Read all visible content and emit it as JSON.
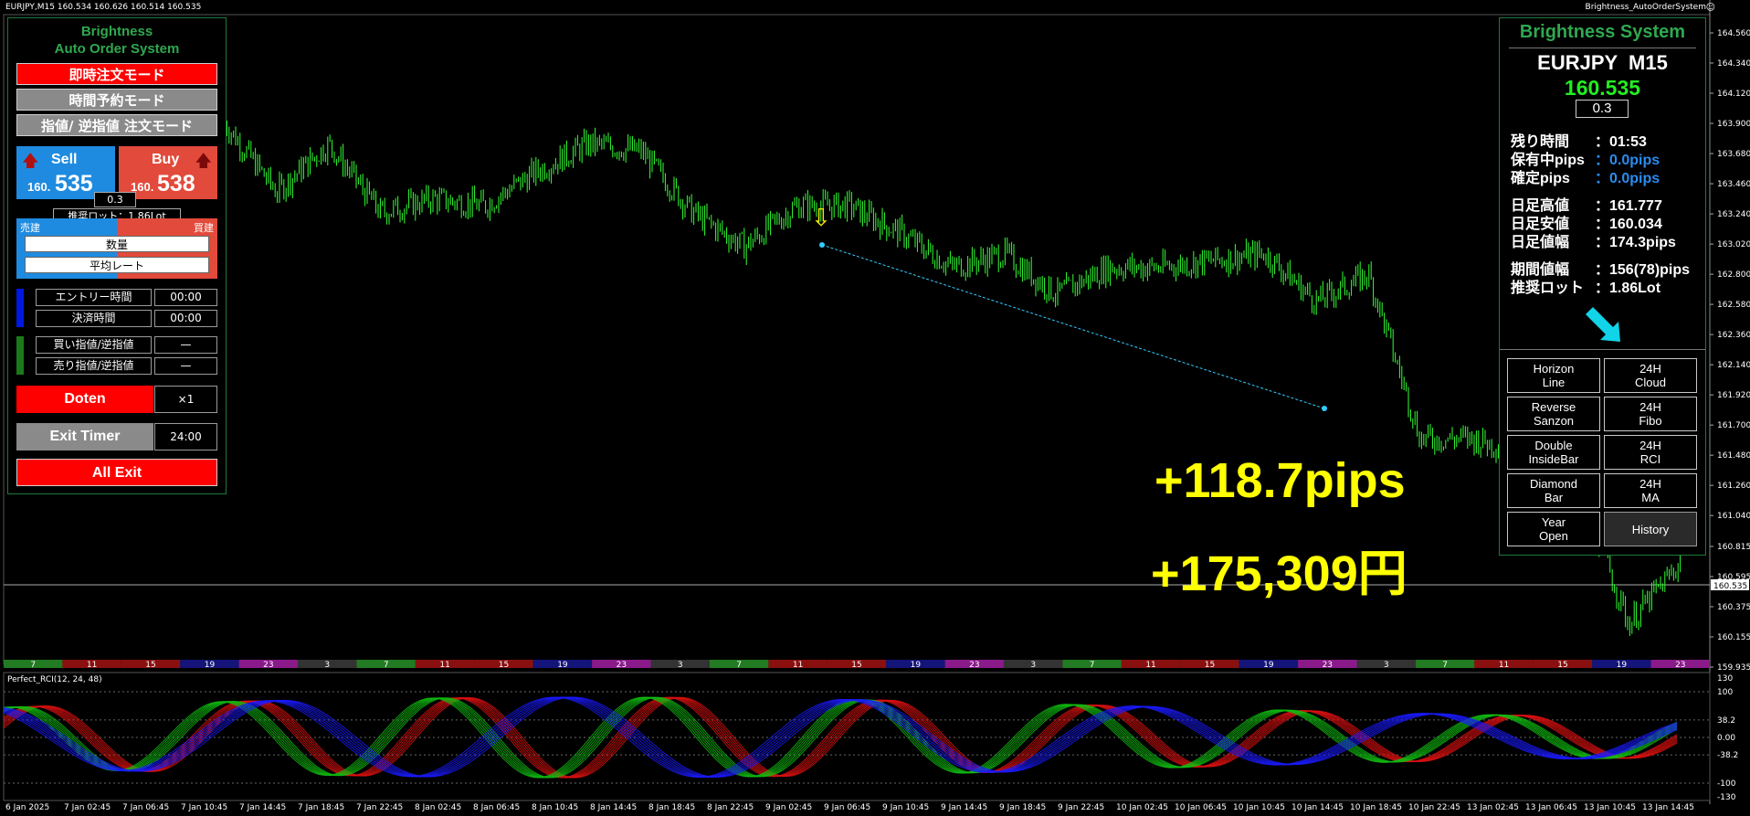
{
  "window": {
    "symbol_info": "EURJPY,M15  160.534 160.626 160.514 160.535",
    "expert_name": "Brightness_AutoOrderSystem",
    "rci_label": "Perfect_RCI(12, 24, 48)"
  },
  "left_panel": {
    "title_line1": "Brightness",
    "title_line2": "Auto Order System",
    "modes": [
      {
        "label": "即時注文モード",
        "active": true
      },
      {
        "label": "時間予約モード",
        "active": false
      },
      {
        "label": "指値/ 逆指値 注文モード",
        "active": false
      }
    ],
    "sell": {
      "label": "Sell",
      "price_small": "160.",
      "price_big": "535"
    },
    "buy": {
      "label": "Buy",
      "price_small": "160.",
      "price_big": "538"
    },
    "spread": "0.3",
    "lot_tooltip": "推奨ロット：1.86Lot",
    "bar_left_label": "売建",
    "bar_right_label": "買建",
    "quantity_label": "数量",
    "avg_rate_label": "平均レート",
    "entry_time_label": "エントリー時間",
    "entry_time_value": "00:00",
    "close_time_label": "決済時間",
    "close_time_value": "00:00",
    "buy_limit_label": "買い指値/逆指値",
    "buy_limit_value": "—",
    "sell_limit_label": "売り指値/逆指値",
    "sell_limit_value": "—",
    "doten_label": "Doten",
    "doten_value": "×1",
    "exit_timer_label": "Exit Timer",
    "exit_timer_value": "24:00",
    "all_exit_label": "All Exit"
  },
  "right_panel": {
    "title": "Brightness System",
    "pair": "EURJPY  M15",
    "price": "160.535",
    "spread": "0.3",
    "rows": [
      {
        "label": "残り時間",
        "value": "：01:53",
        "color": "#ffffff"
      },
      {
        "label": "保有中pips",
        "value": "：0.0pips",
        "color": "#2a8cf0"
      },
      {
        "label": "確定pips",
        "value": "：0.0pips",
        "color": "#2a8cf0"
      },
      {
        "label": "日足高値",
        "value": "：161.777",
        "color": "#ffffff"
      },
      {
        "label": "日足安値",
        "value": "：160.034",
        "color": "#ffffff"
      },
      {
        "label": "日足値幅",
        "value": "：174.3pips",
        "color": "#ffffff"
      },
      {
        "label": "期間値幅",
        "value": "：156(78)pips",
        "color": "#ffffff"
      },
      {
        "label": "推奨ロット",
        "value": "：1.86Lot",
        "color": "#ffffff"
      }
    ],
    "buttons": [
      {
        "label": "Horizon\nLine"
      },
      {
        "label": "24H\nCloud"
      },
      {
        "label": "Reverse\nSanzon"
      },
      {
        "label": "24H\nFibo"
      },
      {
        "label": "Double\nInsideBar"
      },
      {
        "label": "24H\nRCI"
      },
      {
        "label": "Diamond\nBar"
      },
      {
        "label": "24H\nMA"
      },
      {
        "label": "Year\nOpen"
      },
      {
        "label": "History"
      }
    ]
  },
  "overlay": {
    "pips": "+118.7pips",
    "yen": "+175,309円"
  },
  "chart_data": {
    "type": "candlestick",
    "symbol": "EURJPY",
    "timeframe": "M15",
    "price_axis_ticks": [
      "164.560",
      "164.340",
      "164.120",
      "163.900",
      "163.680",
      "163.460",
      "163.240",
      "163.020",
      "162.800",
      "162.580",
      "162.360",
      "162.140",
      "161.920",
      "161.700",
      "161.480",
      "161.260",
      "161.040",
      "160.815",
      "160.595",
      "160.375",
      "160.155",
      "159.935"
    ],
    "current_price": "160.535",
    "ylim": [
      159.935,
      164.56
    ],
    "close_path": [
      [
        "6 Jan 2025",
        163.9
      ],
      [
        "7 Jan 02:45",
        163.4
      ],
      [
        "7 Jan 06:45",
        163.75
      ],
      [
        "7 Jan 10:45",
        163.25
      ],
      [
        "7 Jan 14:45",
        163.35
      ],
      [
        "7 Jan 18:45",
        163.3
      ],
      [
        "7 Jan 22:45",
        163.55
      ],
      [
        "8 Jan 02:45",
        163.75
      ],
      [
        "8 Jan 06:45",
        163.7
      ],
      [
        "8 Jan 10:45",
        163.25
      ],
      [
        "8 Jan 14:45",
        163.0
      ],
      [
        "8 Jan 18:45",
        163.3
      ],
      [
        "8 Jan 22:45",
        163.3
      ],
      [
        "9 Jan 02:45",
        163.1
      ],
      [
        "9 Jan 06:45",
        162.85
      ],
      [
        "9 Jan 10:45",
        162.95
      ],
      [
        "9 Jan 14:45",
        162.65
      ],
      [
        "9 Jan 18:45",
        162.85
      ],
      [
        "9 Jan 22:45",
        162.85
      ],
      [
        "10 Jan 02:45",
        162.9
      ],
      [
        "10 Jan 06:45",
        162.95
      ],
      [
        "10 Jan 10:45",
        162.6
      ],
      [
        "10 Jan 14:45",
        162.8
      ],
      [
        "10 Jan 18:45",
        161.6
      ],
      [
        "10 Jan 22:45",
        161.6
      ],
      [
        "13 Jan 02:45",
        161.5
      ],
      [
        "13 Jan 06:45",
        161.3
      ],
      [
        "13 Jan 10:45",
        160.25
      ],
      [
        "13 Jan 14:45",
        160.7
      ]
    ],
    "time_axis_labels": [
      "6 Jan 2025",
      "7 Jan 02:45",
      "7 Jan 06:45",
      "7 Jan 10:45",
      "7 Jan 14:45",
      "7 Jan 18:45",
      "7 Jan 22:45",
      "8 Jan 02:45",
      "8 Jan 06:45",
      "8 Jan 10:45",
      "8 Jan 14:45",
      "8 Jan 18:45",
      "8 Jan 22:45",
      "9 Jan 02:45",
      "9 Jan 06:45",
      "9 Jan 10:45",
      "9 Jan 14:45",
      "9 Jan 18:45",
      "9 Jan 22:45",
      "10 Jan 02:45",
      "10 Jan 06:45",
      "10 Jan 10:45",
      "10 Jan 14:45",
      "10 Jan 18:45",
      "10 Jan 22:45",
      "13 Jan 02:45",
      "13 Jan 06:45",
      "13 Jan 10:45",
      "13 Jan 14:45"
    ],
    "session_bar": [
      {
        "label": "7",
        "color": "#227a22"
      },
      {
        "label": "11",
        "color": "#8a1010"
      },
      {
        "label": "15",
        "color": "#8a1010"
      },
      {
        "label": "19",
        "color": "#14147a"
      },
      {
        "label": "23",
        "color": "#8a1a8a"
      },
      {
        "label": "3",
        "color": "#333333"
      },
      {
        "label": "7",
        "color": "#227a22"
      },
      {
        "label": "11",
        "color": "#8a1010"
      },
      {
        "label": "15",
        "color": "#8a1010"
      },
      {
        "label": "19",
        "color": "#14147a"
      },
      {
        "label": "23",
        "color": "#8a1a8a"
      },
      {
        "label": "3",
        "color": "#333333"
      },
      {
        "label": "7",
        "color": "#227a22"
      },
      {
        "label": "11",
        "color": "#8a1010"
      },
      {
        "label": "15",
        "color": "#8a1010"
      },
      {
        "label": "19",
        "color": "#14147a"
      },
      {
        "label": "23",
        "color": "#8a1a8a"
      },
      {
        "label": "3",
        "color": "#333333"
      },
      {
        "label": "7",
        "color": "#227a22"
      },
      {
        "label": "11",
        "color": "#8a1010"
      },
      {
        "label": "15",
        "color": "#8a1010"
      },
      {
        "label": "19",
        "color": "#14147a"
      },
      {
        "label": "23",
        "color": "#8a1a8a"
      },
      {
        "label": "3",
        "color": "#333333"
      },
      {
        "label": "7",
        "color": "#227a22"
      },
      {
        "label": "11",
        "color": "#8a1010"
      },
      {
        "label": "15",
        "color": "#8a1010"
      },
      {
        "label": "19",
        "color": "#14147a"
      },
      {
        "label": "23",
        "color": "#8a1a8a"
      }
    ],
    "rci_axis_ticks": [
      "130",
      "100",
      "38.2",
      "0.00",
      "-38.2",
      "-100",
      "-130"
    ],
    "colors": {
      "candle": "#33ff33",
      "trendline": "#33ccff",
      "rci_red": "#dd1111",
      "rci_green": "#11bb11",
      "rci_blue": "#1a1aff"
    }
  }
}
